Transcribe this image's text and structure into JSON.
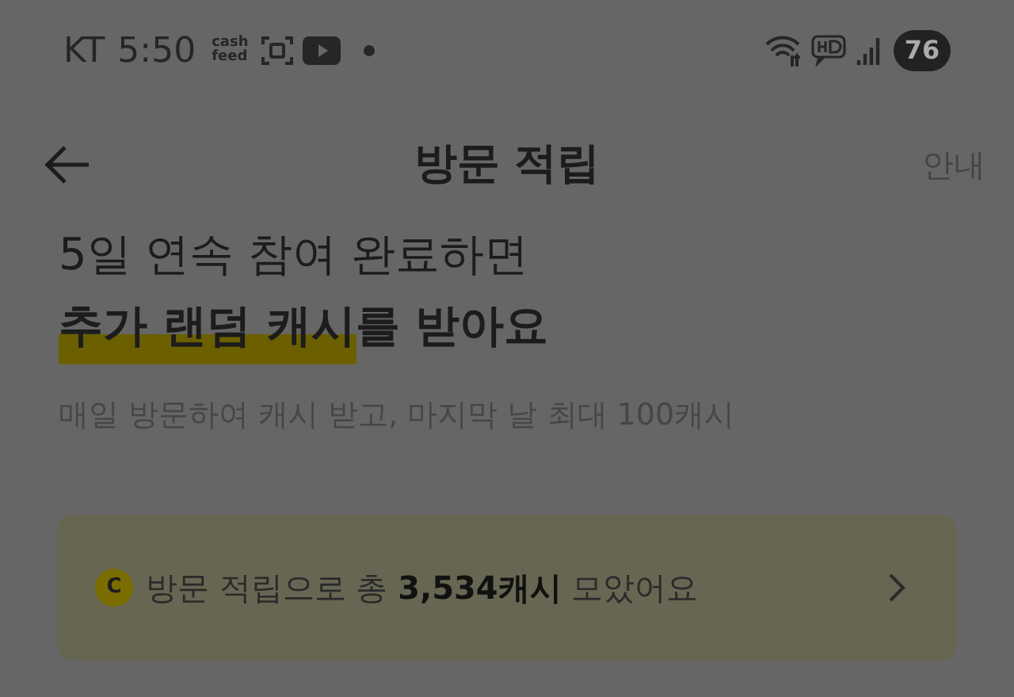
{
  "status_bar": {
    "carrier": "KT",
    "time": "5:50",
    "app_logo": [
      "cash",
      "feed"
    ],
    "battery": "76"
  },
  "header": {
    "title": "방문 적립",
    "action": "안내"
  },
  "intro": {
    "line_1": "5일 연속 참여 완료하면",
    "line_2_highlight": "추가 랜덤 캐시",
    "line_2_rest": "를 받아요",
    "subtitle": "매일 방문하여 캐시 받고, 마지막 날 최대 100캐시"
  },
  "summary_card": {
    "coin": "C",
    "text": "방문 적립으로 총 **3,534캐시** 모았어요"
  }
}
